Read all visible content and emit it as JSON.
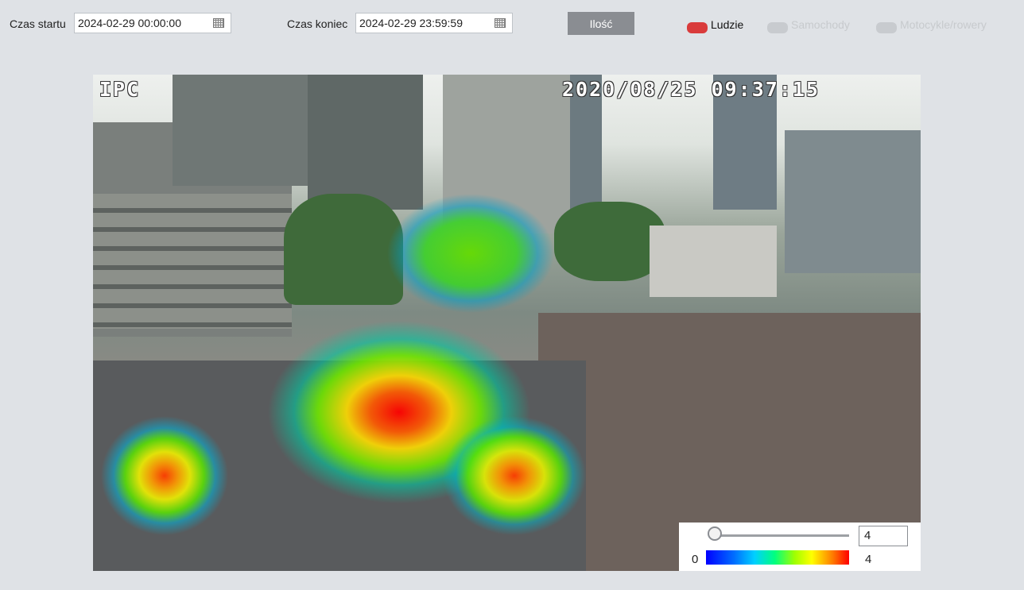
{
  "toolbar": {
    "start_label": "Czas startu",
    "start_value": "2024-02-29 00:00:00",
    "end_label": "Czas koniec",
    "end_value": "2024-02-29 23:59:59",
    "count_button": "Ilość"
  },
  "legend": [
    {
      "label": "Ludzie",
      "active": true,
      "color": "#d93b3b"
    },
    {
      "label": "Samochody",
      "active": false
    },
    {
      "label": "Motocykle/rowery",
      "active": false
    }
  ],
  "camera": {
    "osd_name": "IPC",
    "osd_timestamp": "2020/08/25 09:37:15"
  },
  "scale": {
    "slider_value": "4",
    "min_label": "0",
    "max_label": "4"
  },
  "icons": [
    "calendar-icon"
  ]
}
